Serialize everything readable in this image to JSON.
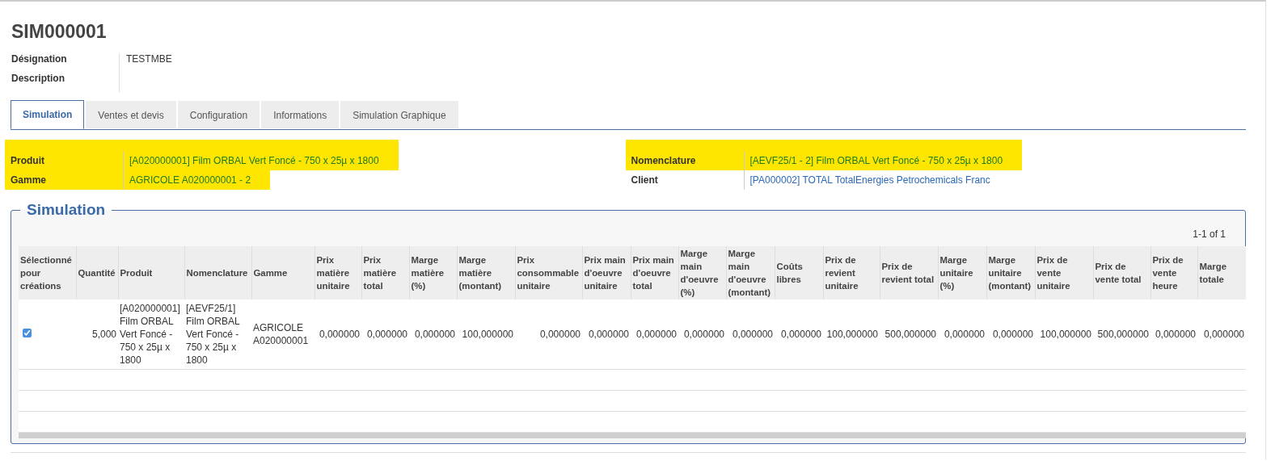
{
  "record": {
    "title": "SIM000001"
  },
  "header_fields": [
    {
      "label": "Désignation",
      "value": "TESTMBE"
    },
    {
      "label": "Description"
    }
  ],
  "tabs": [
    {
      "label": "Simulation",
      "selected": true
    },
    {
      "label": "Ventes et devis",
      "selected": false
    },
    {
      "label": "Configuration",
      "selected": false
    },
    {
      "label": "Informations",
      "selected": false
    },
    {
      "label": "Simulation Graphique",
      "selected": false
    }
  ],
  "fields_left": [
    {
      "label": "Produit",
      "value": "[A020000001] Film ORBAL Vert Foncé - 750 x 25µ x 1800",
      "highlighted": true
    },
    {
      "label": "Gamme",
      "value": "AGRICOLE A020000001 - 2",
      "highlighted": true
    }
  ],
  "fields_right": [
    {
      "label": "Nomenclature",
      "value": "[AEVF25/1 - 2] Film ORBAL Vert Foncé - 750 x 25µ x 1800",
      "highlighted": true
    },
    {
      "label": "Client",
      "value": "[PA000002] TOTAL TotalEnergies Petrochemicals Franc",
      "highlighted": false
    }
  ],
  "section": {
    "title": "Simulation",
    "pager": "1-1 of 1"
  },
  "table": {
    "columns": [
      "Sélectionné pour créations",
      "Quantité",
      "Produit",
      "Nomenclature",
      "Gamme",
      "Prix matière unitaire",
      "Prix matière total",
      "Marge matière (%)",
      "Marge matière (montant)",
      "Prix consommable unitaire",
      "Prix main d'oeuvre unitaire",
      "Prix main d'oeuvre total",
      "Marge main d'oeuvre (%)",
      "Marge main d'oeuvre (montant)",
      "Coûts libres",
      "Prix de revient unitaire",
      "Prix de revient total",
      "Marge unitaire (%)",
      "Marge unitaire (montant)",
      "Prix de vente unitaire",
      "Prix de vente total",
      "Prix de vente heure",
      "Marge totale"
    ],
    "rows": [
      {
        "cells": [
          {
            "kind": "checkbox",
            "checked": true
          },
          "5,000",
          "[A020000001] Film ORBAL Vert Foncé - 750 x 25µ x 1800",
          "[AEVF25/1] Film ORBAL Vert Foncé - 750 x 25µ x 1800",
          "AGRICOLE A020000001",
          "0,000000",
          "0,000000",
          "0,000000",
          "100,000000",
          "0,000000",
          "0,000000",
          "0,000000",
          "0,000000",
          "0,000000",
          "0,000000",
          "100,000000",
          "500,000000",
          "0,000000",
          "0,000000",
          "100,000000",
          "500,000000",
          "0,000000",
          "0,000000"
        ]
      }
    ]
  }
}
